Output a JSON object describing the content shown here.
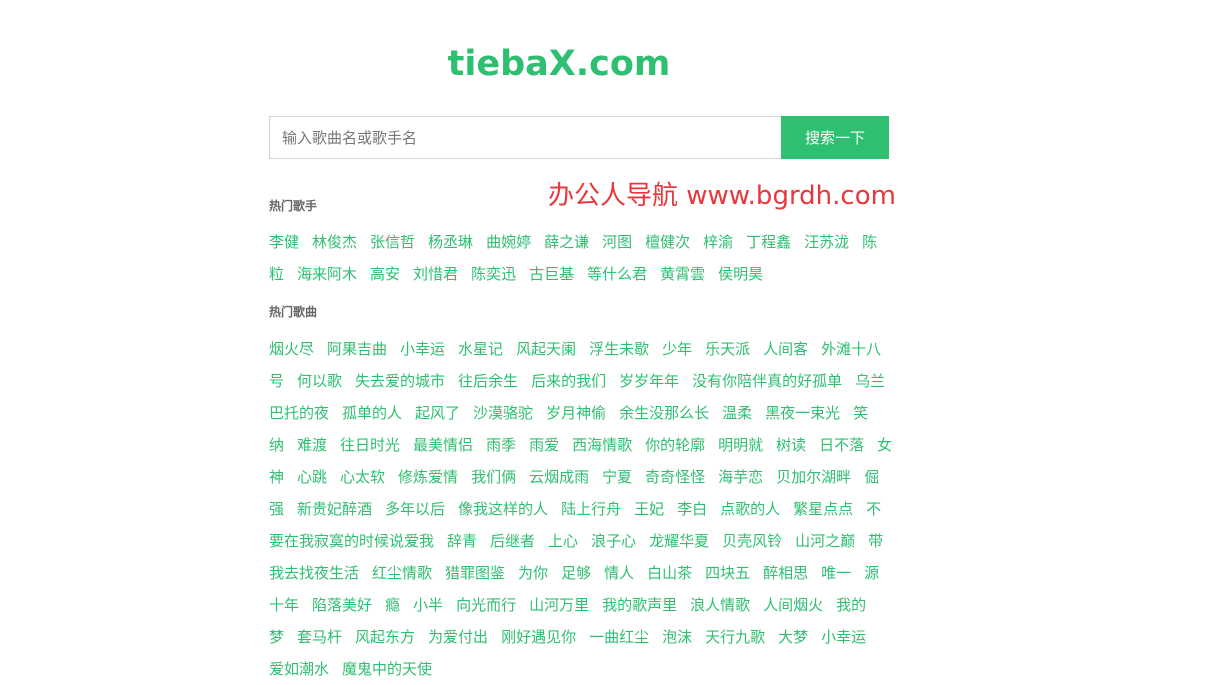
{
  "logo": "tiebaX.com",
  "search": {
    "placeholder": "输入歌曲名或歌手名",
    "button_label": "搜索一下"
  },
  "watermark": "办公人导航 www.bgrdh.com",
  "hot_singers": {
    "title": "热门歌手",
    "items": [
      "李健",
      "林俊杰",
      "张信哲",
      "杨丞琳",
      "曲婉婷",
      "薛之谦",
      "河图",
      "檀健次",
      "梓渝",
      "丁程鑫",
      "汪苏泷",
      "陈粒",
      "海来阿木",
      "高安",
      "刘惜君",
      "陈奕迅",
      "古巨基",
      "等什么君",
      "黄霄雲",
      "侯明昊"
    ]
  },
  "hot_songs": {
    "title": "热门歌曲",
    "items": [
      "烟火尽",
      "阿果吉曲",
      "小幸运",
      "水星记",
      "风起天阑",
      "浮生未歇",
      "少年",
      "乐天派",
      "人间客",
      "外滩十八号",
      "何以歌",
      "失去爱的城市",
      "往后余生",
      "后来的我们",
      "岁岁年年",
      "没有你陪伴真的好孤单",
      "乌兰巴托的夜",
      "孤单的人",
      "起风了",
      "沙漠骆驼",
      "岁月神偷",
      "余生没那么长",
      "温柔",
      "黑夜一束光",
      "笑纳",
      "难渡",
      "往日时光",
      "最美情侣",
      "雨季",
      "雨爱",
      "西海情歌",
      "你的轮廓",
      "明明就",
      "树读",
      "日不落",
      "女神",
      "心跳",
      "心太软",
      "修炼爱情",
      "我们俩",
      "云烟成雨",
      "宁夏",
      "奇奇怪怪",
      "海芋恋",
      "贝加尔湖畔",
      "倔强",
      "新贵妃醉酒",
      "多年以后",
      "像我这样的人",
      "陆上行舟",
      "王妃",
      "李白",
      "点歌的人",
      "繁星点点",
      "不要在我寂寞的时候说爱我",
      "辞青",
      "后继者",
      "上心",
      "浪子心",
      "龙耀华夏",
      "贝壳风铃",
      "山河之巅",
      "带我去找夜生活",
      "红尘情歌",
      "猎罪图鉴",
      "为你",
      "足够",
      "情人",
      "白山茶",
      "四块五",
      "醉相思",
      "唯一",
      "源",
      "十年",
      "陷落美好",
      "瘾",
      "小半",
      "向光而行",
      "山河万里",
      "我的歌声里",
      "浪人情歌",
      "人间烟火",
      "我的梦",
      "套马杆",
      "风起东方",
      "为爱付出",
      "刚好遇见你",
      "一曲红尘",
      "泡沫",
      "天行九歌",
      "大梦",
      "小幸运",
      "爱如潮水",
      "魔鬼中的天使"
    ]
  }
}
